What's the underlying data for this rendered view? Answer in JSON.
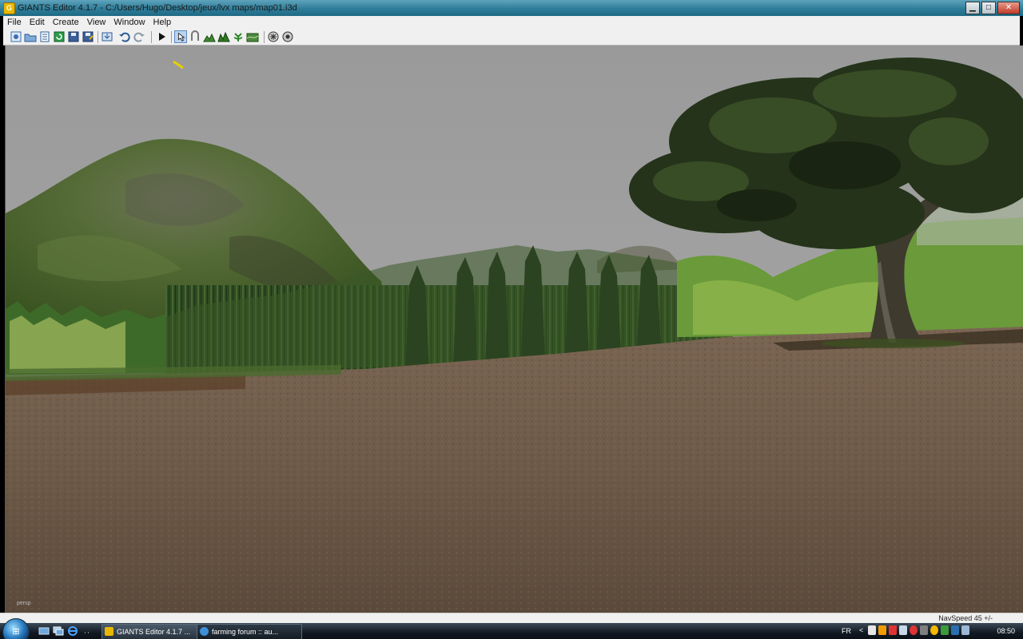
{
  "window": {
    "title": "GIANTS Editor 4.1.7 - C:/Users/Hugo/Desktop/jeux/lvx maps/map01.i3d",
    "app_icon_letter": "G",
    "minimize_glyph": "▁",
    "maximize_glyph": "□",
    "close_glyph": "✕"
  },
  "menu": [
    "File",
    "Edit",
    "Create",
    "View",
    "Window",
    "Help"
  ],
  "toolbar": {
    "icons": [
      "new-scene-icon",
      "open-icon",
      "properties-icon",
      "refresh-icon",
      "save-icon",
      "save-as-icon",
      "import-icon",
      "undo-icon",
      "redo-icon",
      "play-icon",
      "select-tool-icon",
      "move-tool-icon",
      "terrain-sculpt-icon",
      "terrain-paint-icon",
      "foliage-paint-icon",
      "terrain-smooth-icon",
      "particle-icon",
      "settings-icon"
    ]
  },
  "viewport": {
    "camera_label": "persp",
    "sky_color": "#9d9d9d",
    "ground_color": "#6e5a48"
  },
  "status": {
    "nav_speed": "NavSpeed 45 +/-"
  },
  "taskbar": {
    "start_glyph": "⊞",
    "tasks": [
      {
        "label": "GIANTS Editor 4.1.7 ...",
        "icon": "giants-editor-icon"
      },
      {
        "label": "farming forum :: au...",
        "icon": "internet-explorer-icon"
      }
    ],
    "language": "FR",
    "tray_arrow": "<",
    "clock": "08:50",
    "colors": {
      "accent": "#2e7d99",
      "taskbar": "#111922"
    }
  }
}
